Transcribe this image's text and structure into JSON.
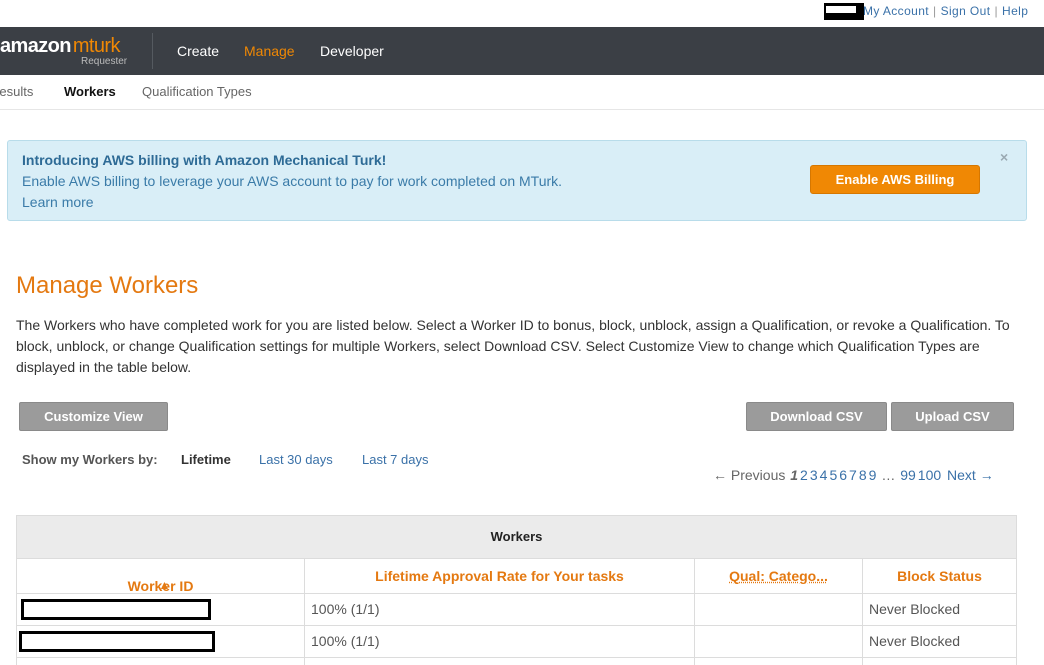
{
  "topbar": {
    "links": [
      "My Account",
      "Sign Out",
      "Help"
    ]
  },
  "nav": {
    "logo_main": "amazon",
    "logo_accent": "mturk",
    "logo_sub": "Requester",
    "items": [
      {
        "label": "Create"
      },
      {
        "label": "Manage"
      },
      {
        "label": "Developer"
      }
    ]
  },
  "subnav": {
    "items": [
      {
        "label": "Results"
      },
      {
        "label": "Workers"
      },
      {
        "label": "Qualification Types"
      }
    ]
  },
  "banner": {
    "title": "Introducing AWS billing with Amazon Mechanical Turk!",
    "text": "Enable AWS billing to leverage your AWS account to pay for work completed on MTurk.",
    "link": "Learn more",
    "button": "Enable AWS Billing",
    "close": "×"
  },
  "page": {
    "title": "Manage Workers",
    "intro": "The Workers who have completed work for you are listed below. Select a Worker ID to bonus, block, unblock, assign a Qualification, or revoke a Qualification. To block, unblock, or change Qualification settings for multiple Workers, select Download CSV. Select Customize View to change which Qualification Types are displayed in the table below."
  },
  "buttons": {
    "customize": "Customize View",
    "download": "Download CSV",
    "upload": "Upload CSV"
  },
  "filter": {
    "label": "Show my Workers by:",
    "options": [
      "Lifetime",
      "Last 30 days",
      "Last 7 days"
    ]
  },
  "pager": {
    "prev": "← Previous",
    "current": "1",
    "pages": [
      "2",
      "3",
      "4",
      "5",
      "6",
      "7",
      "8",
      "9"
    ],
    "ellipsis": "…",
    "tail": [
      "99",
      "100"
    ],
    "next": "Next →"
  },
  "table": {
    "title": "Workers",
    "columns": [
      "Worker ID",
      "Lifetime Approval Rate for Your tasks",
      "Qual: Catego...",
      "Block Status"
    ],
    "sort_icon": "▲",
    "rows": [
      {
        "worker_id": "",
        "approval": "100% (1/1)",
        "qual": "",
        "block": "Never Blocked"
      },
      {
        "worker_id": "",
        "approval": "100% (1/1)",
        "qual": "",
        "block": "Never Blocked"
      }
    ]
  },
  "colors": {
    "accent": "#f08804",
    "nav_bg": "#3b3f45",
    "link": "#3a71a8",
    "banner_bg": "#d9eef7"
  }
}
